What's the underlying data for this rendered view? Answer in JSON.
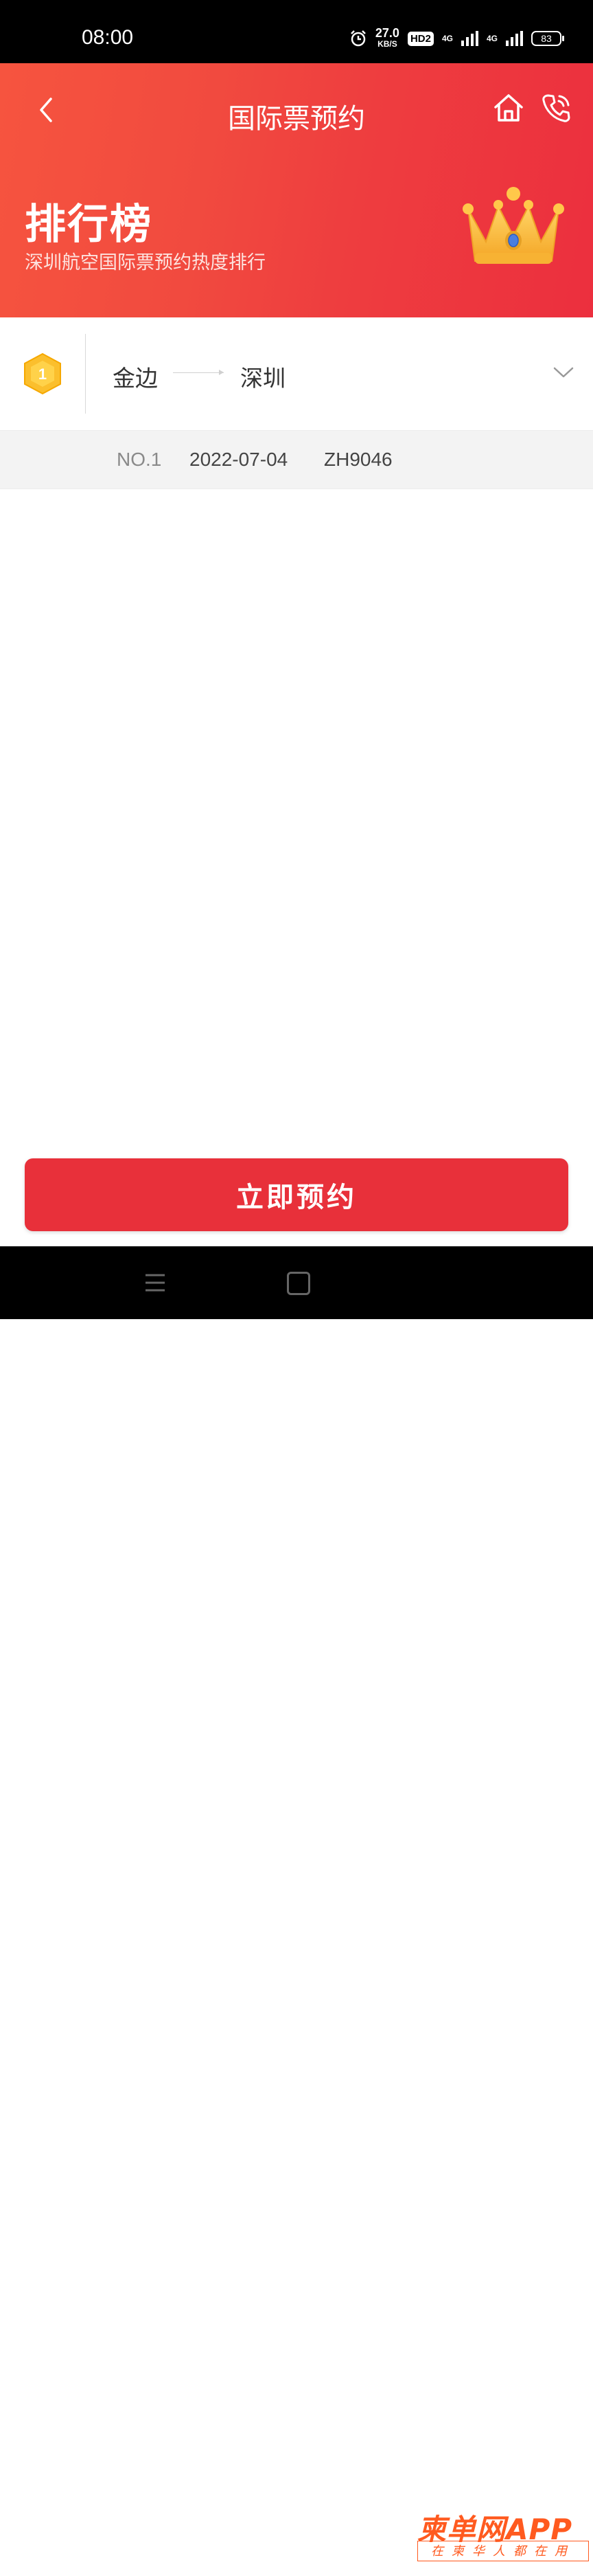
{
  "status_bar": {
    "time": "08:00",
    "speed_value": "27.0",
    "speed_unit": "KB/S",
    "hd_label": "HD2",
    "network_1": "4G",
    "network_2": "4G",
    "battery": "83"
  },
  "header": {
    "nav_title": "国际票预约",
    "back_icon": "back-arrow-icon",
    "home_icon": "home-icon",
    "phone_icon": "phone-icon",
    "title": "排行榜",
    "subtitle": "深圳航空国际票预约热度排行",
    "crown_icon": "crown-icon"
  },
  "route": {
    "rank": "1",
    "from": "金边",
    "to": "深圳",
    "expand_icon": "chevron-down-icon"
  },
  "detail": {
    "no": "NO.1",
    "date": "2022-07-04",
    "flight": "ZH9046"
  },
  "actions": {
    "reserve_label": "立即预约"
  },
  "watermark": {
    "main": "柬单网APP",
    "sub": "在柬华人都在用"
  },
  "colors": {
    "header_start": "#f6543f",
    "header_end": "#ec2f3e",
    "button": "#e8303a",
    "badge_gold": "#fbbf2d"
  }
}
